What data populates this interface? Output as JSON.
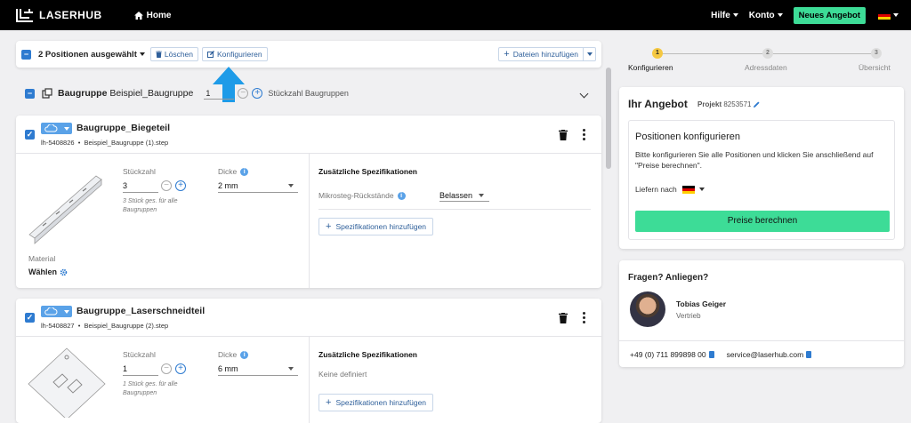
{
  "header": {
    "brand": "LASERHUB",
    "home": "Home",
    "menus": [
      "Hilfe",
      "Konto"
    ],
    "new_offer": "Neues Angebot"
  },
  "toolbar": {
    "selected_label": "2 Positionen ausgewählt",
    "delete": "Löschen",
    "configure": "Konfigurieren",
    "add_files": "Dateien hinzufügen"
  },
  "group": {
    "label": "Baugruppe",
    "name": "Beispiel_Baugruppe",
    "quantity": "1",
    "quantity_label": "Stückzahl Baugruppen"
  },
  "parts": [
    {
      "title": "Baugruppe_Biegeteil",
      "id": "lh-5408826",
      "file": "Beispiel_Baugruppe (1).step",
      "qty_label": "Stückzahl",
      "qty": "3",
      "qty_hint": "3 Stück ges. für alle Baugruppen",
      "thickness_label": "Dicke",
      "thickness": "2 mm",
      "material_label": "Material",
      "material_value": "Wählen",
      "spec_title": "Zusätzliche Spezifikationen",
      "spec_row_label": "Mikrosteg-Rückstände",
      "spec_row_value": "Belassen",
      "add_spec": "Spezifikationen hinzufügen"
    },
    {
      "title": "Baugruppe_Laserschneidteil",
      "id": "lh-5408827",
      "file": "Beispiel_Baugruppe (2).step",
      "qty_label": "Stückzahl",
      "qty": "1",
      "qty_hint": "1 Stück ges. für alle Baugruppen",
      "thickness_label": "Dicke",
      "thickness": "6 mm",
      "spec_title": "Zusätzliche Spezifikationen",
      "spec_none": "Keine definiert",
      "add_spec": "Spezifikationen hinzufügen"
    }
  ],
  "steps": [
    {
      "num": "1",
      "label": "Konfigurieren",
      "active": true
    },
    {
      "num": "2",
      "label": "Adressdaten",
      "active": false
    },
    {
      "num": "3",
      "label": "Übersicht",
      "active": false
    }
  ],
  "offer": {
    "title": "Ihr Angebot",
    "project_label": "Projekt",
    "project_id": "8253571",
    "section_title": "Positionen konfigurieren",
    "section_text": "Bitte konfigurieren Sie alle Positionen und klicken Sie anschließend auf \"Preise berechnen\".",
    "deliver_label": "Liefern nach",
    "calc_button": "Preise berechnen"
  },
  "contact": {
    "title": "Fragen? Anliegen?",
    "name": "Tobias Geiger",
    "role": "Vertrieb",
    "phone": "+49 (0) 711 899898 00",
    "email": "service@laserhub.com"
  },
  "colors": {
    "accent_green": "#3ddc97",
    "primary_blue": "#2e7bd0",
    "arrow_blue": "#1e9be8",
    "step_active": "#f5c842"
  }
}
